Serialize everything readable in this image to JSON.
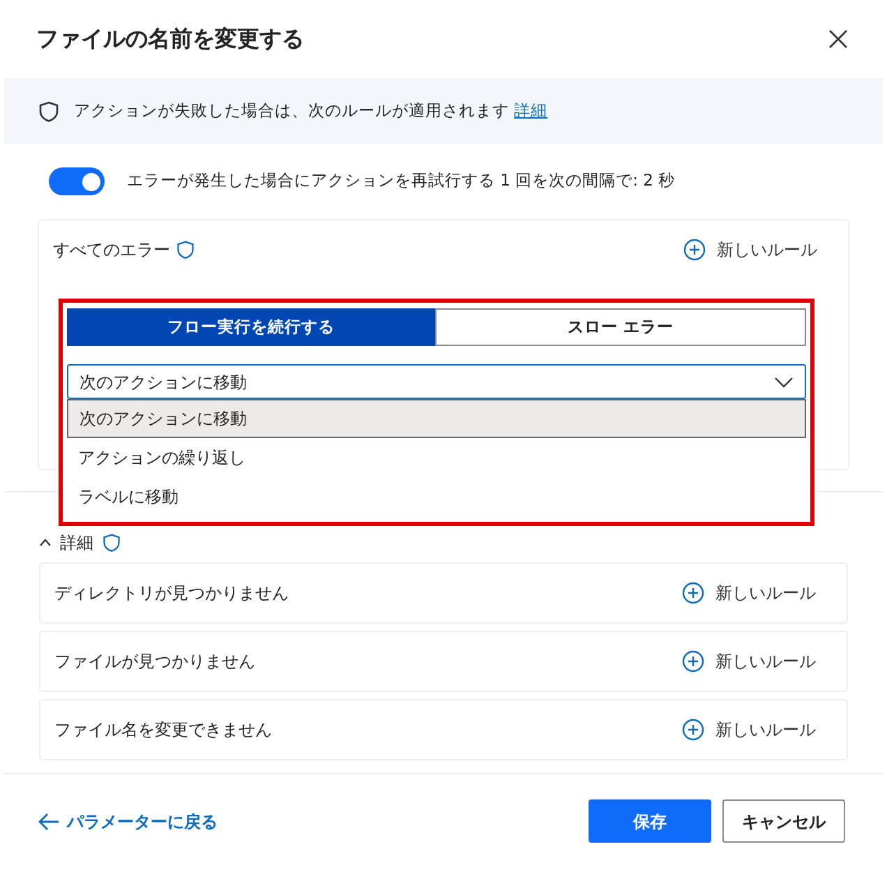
{
  "dialog": {
    "title": "ファイルの名前を変更する"
  },
  "banner": {
    "text": "アクションが失敗した場合は、次のルールが適用されます",
    "link": "詳細"
  },
  "retry": {
    "on": true,
    "text": "エラーが発生した場合にアクションを再試行する 1 回を次の間隔で: 2 秒"
  },
  "all_errors": {
    "label": "すべてのエラー",
    "new_rule": "新しいルール"
  },
  "action_tabs": [
    {
      "label": "フロー実行を続行する",
      "selected": true
    },
    {
      "label": "スロー エラー",
      "selected": false
    }
  ],
  "action_select": {
    "value": "次のアクションに移動",
    "options": [
      {
        "label": "次のアクションに移動",
        "selected": true
      },
      {
        "label": "アクションの繰り返し",
        "selected": false
      },
      {
        "label": "ラベルに移動",
        "selected": false
      }
    ]
  },
  "details": {
    "label": "詳細",
    "expanded": true
  },
  "rules": [
    {
      "label": "ディレクトリが見つかりません",
      "new_rule": "新しいルール"
    },
    {
      "label": "ファイルが見つかりません",
      "new_rule": "新しいルール"
    },
    {
      "label": "ファイル名を変更できません",
      "new_rule": "新しいルール"
    }
  ],
  "footer": {
    "back": "パラメーターに戻る",
    "save": "保存",
    "cancel": "キャンセル"
  }
}
